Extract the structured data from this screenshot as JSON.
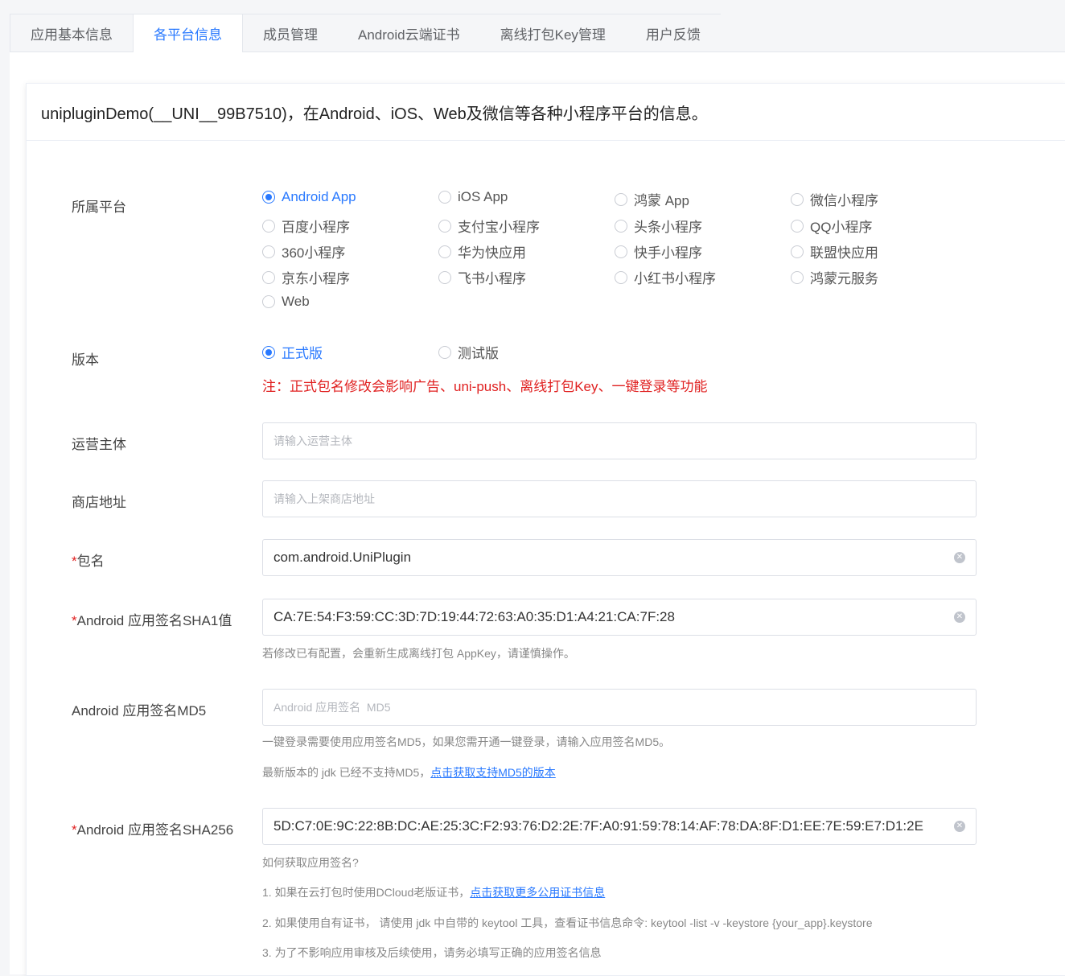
{
  "tabs": [
    "应用基本信息",
    "各平台信息",
    "成员管理",
    "Android云端证书",
    "离线打包Key管理",
    "用户反馈"
  ],
  "card_title": "uniplugin​Demo(__UNI__99B7510)，在Android、iOS、Web及微信等各种小程序平台的信息。",
  "platform": {
    "label": "所属平台",
    "options": [
      "Android App",
      "iOS App",
      "鸿蒙 App",
      "微信小程序",
      "百度小程序",
      "支付宝小程序",
      "头条小程序",
      "QQ小程序",
      "360小程序",
      "华为快应用",
      "快手小程序",
      "联盟快应用",
      "京东小程序",
      "飞书小程序",
      "小红书小程序",
      "鸿蒙元服务",
      "Web"
    ],
    "selected": "Android App"
  },
  "version": {
    "label": "版本",
    "options": [
      "正式版",
      "测试版"
    ],
    "selected": "正式版",
    "notice": "注：正式包名修改会影响广告、uni-push、离线打包Key、一键登录等功能"
  },
  "operator": {
    "label": "运营主体",
    "placeholder": "请输入运营主体"
  },
  "store": {
    "label": "商店地址",
    "placeholder": "请输入上架商店地址"
  },
  "package": {
    "required": "*",
    "label": "包名",
    "value": "com.android.UniPlugin"
  },
  "sha1": {
    "required": "*",
    "label": "Android 应用签名SHA1值",
    "value": "CA:7E:54:F3:59:CC:3D:7D:19:44:72:63:A0:35:D1:A4:21:CA:7F:28",
    "help": "若修改已有配置，会重新生成离线打包 AppKey，请谨慎操作。"
  },
  "md5": {
    "label": "Android 应用签名MD5",
    "placeholder": "Android 应用签名  MD5",
    "help1": "一键登录需要使用应用签名MD5，如果您需开通一键登录，请输入应用签名MD5。",
    "help2": "最新版本的 jdk 已经不支持MD5，",
    "help2_link": "点击获取支持MD5的版本"
  },
  "sha256": {
    "required": "*",
    "label": "Android 应用签名SHA256",
    "value": "5D:C7:0E:9C:22:8B:DC:AE:25:3C:F2:93:76:D2:2E:7F:A0:91:59:78:14:AF:78:DA:8F:D1:EE:7E:59:E7:D1:2E",
    "help_title": "如何获取应用签名?",
    "help1": "1. 如果在云打包时使用DCloud老版证书，",
    "help1_link": "点击获取更多公用证书信息",
    "help2": "2. 如果使用自有证书， 请使用 jdk 中自带的 keytool 工具，查看证书信息命令: keytool -list -v -keystore {your_app}.keystore",
    "help3": "3. 为了不影响应用审核及后续使用，请务必填写正确的应用签名信息"
  }
}
